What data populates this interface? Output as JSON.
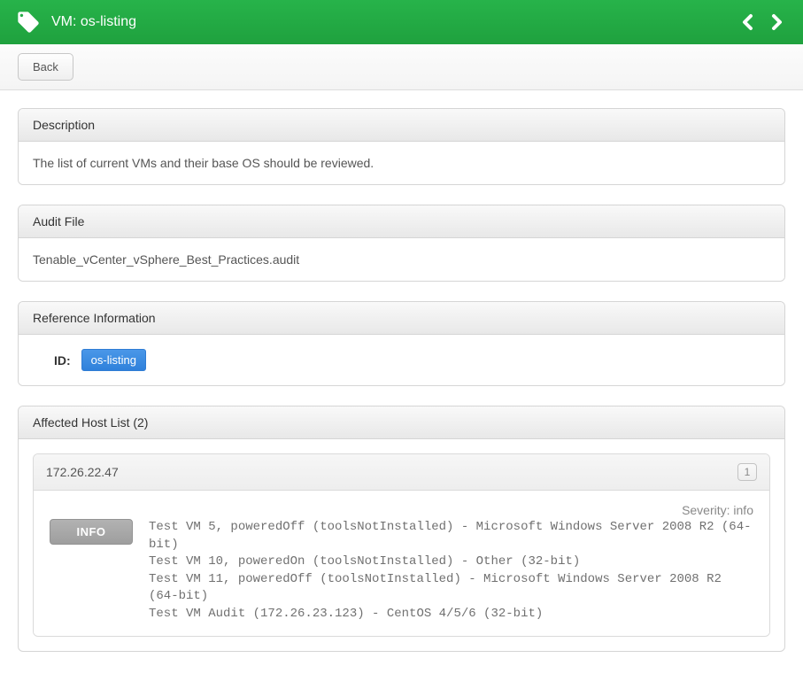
{
  "header": {
    "title": "VM: os-listing"
  },
  "back_label": "Back",
  "sections": {
    "description": {
      "title": "Description",
      "text": "The list of current VMs and their base OS should be reviewed."
    },
    "audit": {
      "title": "Audit File",
      "text": "Tenable_vCenter_vSphere_Best_Practices.audit"
    },
    "reference": {
      "title": "Reference Information",
      "id_label": "ID:",
      "id_value": "os-listing"
    },
    "hosts": {
      "title": "Affected Host List (2)",
      "host_ip": "172.26.22.47",
      "count": "1",
      "severity_label": "Severity: info",
      "badge": "INFO",
      "output": "Test VM 5, poweredOff (toolsNotInstalled) - Microsoft Windows Server 2008 R2 (64-bit)\nTest VM 10, poweredOn (toolsNotInstalled) - Other (32-bit)\nTest VM 11, poweredOff (toolsNotInstalled) - Microsoft Windows Server 2008 R2 (64-bit)\nTest VM Audit (172.26.23.123) - CentOS 4/5/6 (32-bit)"
    }
  }
}
